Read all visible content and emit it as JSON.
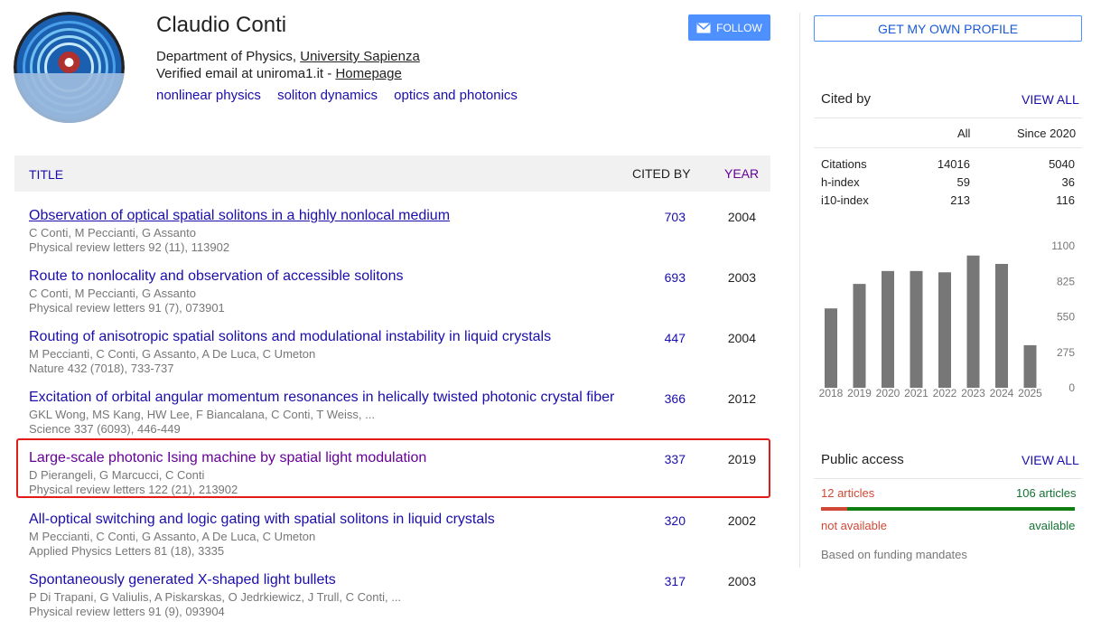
{
  "profile": {
    "name": "Claudio Conti",
    "dept_prefix": "Department of Physics,",
    "university": "University Sapienza",
    "email_prefix": "Verified email at uniroma1.it -",
    "homepage": "Homepage",
    "interests": [
      "nonlinear physics",
      "soliton dynamics",
      "optics and photonics"
    ],
    "follow_label": "FOLLOW"
  },
  "table": {
    "headers": {
      "title": "TITLE",
      "cited_by": "CITED BY",
      "year": "YEAR"
    },
    "rows": [
      {
        "title": "Observation of optical spatial solitons in a highly nonlocal medium",
        "authors": "C Conti, M Peccianti, G Assanto",
        "venue": "Physical review letters 92 (11), 113902",
        "cited": "703",
        "year": "2004"
      },
      {
        "title": "Route to nonlocality and observation of accessible solitons",
        "authors": "C Conti, M Peccianti, G Assanto",
        "venue": "Physical review letters 91 (7), 073901",
        "cited": "693",
        "year": "2003"
      },
      {
        "title": "Routing of anisotropic spatial solitons and modulational instability in liquid crystals",
        "authors": "M Peccianti, C Conti, G Assanto, A De Luca, C Umeton",
        "venue": "Nature 432 (7018), 733-737",
        "cited": "447",
        "year": "2004"
      },
      {
        "title": "Excitation of orbital angular momentum resonances in helically twisted photonic crystal fiber",
        "authors": "GKL Wong, MS Kang, HW Lee, F Biancalana, C Conti, T Weiss, ...",
        "venue": "Science 337 (6093), 446-449",
        "cited": "366",
        "year": "2012"
      },
      {
        "title": "Large-scale photonic Ising machine by spatial light modulation",
        "authors": "D Pierangeli, G Marcucci, C Conti",
        "venue": "Physical review letters 122 (21), 213902",
        "cited": "337",
        "year": "2019"
      },
      {
        "title": "All-optical switching and logic gating with spatial solitons in liquid crystals",
        "authors": "M Peccianti, C Conti, G Assanto, A De Luca, C Umeton",
        "venue": "Applied Physics Letters 81 (18), 3335",
        "cited": "320",
        "year": "2002"
      },
      {
        "title": "Spontaneously generated X-shaped light bullets",
        "authors": "P Di Trapani, G Valiulis, A Piskarskas, O Jedrkiewicz, J Trull, C Conti, ...",
        "venue": "Physical review letters 91 (9), 093904",
        "cited": "317",
        "year": "2003"
      }
    ]
  },
  "sidebar": {
    "get_profile": "GET MY OWN PROFILE",
    "cited_by": {
      "title": "Cited by",
      "view_all": "VIEW ALL",
      "col_all": "All",
      "col_since": "Since 2020",
      "stats": [
        {
          "label": "Citations",
          "all": "14016",
          "since": "5040"
        },
        {
          "label": "h-index",
          "all": "59",
          "since": "36"
        },
        {
          "label": "i10-index",
          "all": "213",
          "since": "116"
        }
      ]
    },
    "public_access": {
      "title": "Public access",
      "view_all": "VIEW ALL",
      "not_available_count": "12 articles",
      "available_count": "106 articles",
      "not_available": "not available",
      "available": "available",
      "note": "Based on funding mandates",
      "not_available_fraction": 0.1017
    }
  },
  "chart_data": {
    "type": "bar",
    "categories": [
      "2018",
      "2019",
      "2020",
      "2021",
      "2022",
      "2023",
      "2024",
      "2025"
    ],
    "values": [
      615,
      805,
      905,
      905,
      895,
      1025,
      960,
      330
    ],
    "yticks": [
      "1100",
      "825",
      "550",
      "275",
      "0"
    ],
    "ylim": [
      0,
      1100
    ],
    "bar_color": "#777777"
  },
  "colors": {
    "link": "#1a0dab",
    "visited": "#660099",
    "accent": "#4d90fe",
    "highlight": "#e21b1b"
  }
}
